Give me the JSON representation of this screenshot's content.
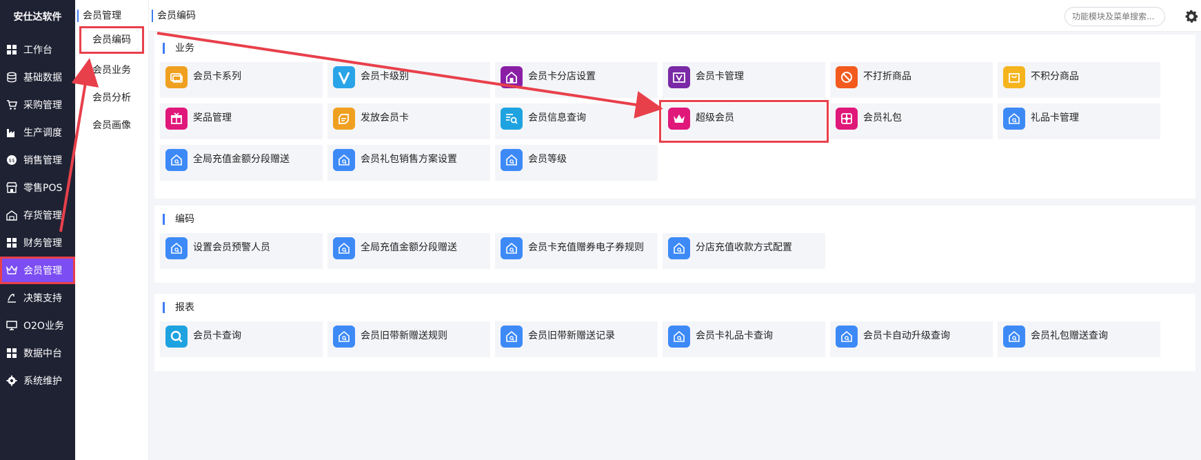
{
  "brand": "安仕达软件",
  "nav": [
    {
      "label": "工作台",
      "icon": "grid-icon"
    },
    {
      "label": "基础数据",
      "icon": "database-icon"
    },
    {
      "label": "采购管理",
      "icon": "cart-icon"
    },
    {
      "label": "生产调度",
      "icon": "factory-icon"
    },
    {
      "label": "销售管理",
      "icon": "sales-icon"
    },
    {
      "label": "零售POS",
      "icon": "store-icon"
    },
    {
      "label": "存货管理",
      "icon": "warehouse-icon"
    },
    {
      "label": "财务管理",
      "icon": "grid-icon"
    },
    {
      "label": "会员管理",
      "icon": "crown-icon"
    },
    {
      "label": "决策支持",
      "icon": "chart-icon"
    },
    {
      "label": "O2O业务",
      "icon": "monitor-icon"
    },
    {
      "label": "数据中台",
      "icon": "grid-icon"
    },
    {
      "label": "系统维护",
      "icon": "gear-icon"
    }
  ],
  "sub": {
    "title": "会员管理",
    "items": [
      {
        "label": "会员编码"
      },
      {
        "label": "会员业务"
      },
      {
        "label": "会员分析"
      },
      {
        "label": "会员画像"
      }
    ]
  },
  "topbar": {
    "breadcrumb": "会员编码",
    "search_placeholder": "功能模块及菜单搜索..."
  },
  "sections": [
    {
      "title": "业务",
      "cards": [
        {
          "label": "会员卡系列",
          "icon": "card-series-icon",
          "color": "#f0a020"
        },
        {
          "label": "会员卡级别",
          "icon": "v-level-icon",
          "color": "#2aa4e8"
        },
        {
          "label": "会员卡分店设置",
          "icon": "store-setting-icon",
          "color": "#8a1fa6"
        },
        {
          "label": "会员卡管理",
          "icon": "v-card-icon",
          "color": "#7a2aa6"
        },
        {
          "label": "不打折商品",
          "icon": "no-discount-icon",
          "color": "#f25a1e"
        },
        {
          "label": "不积分商品",
          "icon": "bag-icon",
          "color": "#f5b41e"
        },
        {
          "label": "奖品管理",
          "icon": "gift-icon",
          "color": "#e0187a"
        },
        {
          "label": "发放会员卡",
          "icon": "issue-card-icon",
          "color": "#f0a020"
        },
        {
          "label": "会员信息查询",
          "icon": "search-list-icon",
          "color": "#1fa3e0"
        },
        {
          "label": "超级会员",
          "icon": "crown-icon",
          "color": "#e0187a"
        },
        {
          "label": "会员礼包",
          "icon": "package-icon",
          "color": "#e0187a"
        },
        {
          "label": "礼品卡管理",
          "icon": "home-search-icon",
          "color": "#3d8af7"
        },
        {
          "label": "全局充值金额分段赠送",
          "icon": "home-search-icon",
          "color": "#3d8af7"
        },
        {
          "label": "会员礼包销售方案设置",
          "icon": "home-search-icon",
          "color": "#3d8af7"
        },
        {
          "label": "会员等级",
          "icon": "home-search-icon",
          "color": "#3d8af7"
        }
      ]
    },
    {
      "title": "编码",
      "cards": [
        {
          "label": "设置会员预警人员",
          "icon": "home-search-icon",
          "color": "#3d8af7"
        },
        {
          "label": "全局充值金额分段赠送",
          "icon": "home-search-icon",
          "color": "#3d8af7"
        },
        {
          "label": "会员卡充值赠券电子券规则",
          "icon": "home-search-icon",
          "color": "#3d8af7"
        },
        {
          "label": "分店充值收款方式配置",
          "icon": "home-search-icon",
          "color": "#3d8af7"
        }
      ]
    },
    {
      "title": "报表",
      "cards": [
        {
          "label": "会员卡查询",
          "icon": "magnifier-icon",
          "color": "#1fa3e0"
        },
        {
          "label": "会员旧带新赠送规则",
          "icon": "home-search-icon",
          "color": "#3d8af7"
        },
        {
          "label": "会员旧带新赠送记录",
          "icon": "home-search-icon",
          "color": "#3d8af7"
        },
        {
          "label": "会员卡礼品卡查询",
          "icon": "home-search-icon",
          "color": "#3d8af7"
        },
        {
          "label": "会员卡自动升级查询",
          "icon": "home-search-icon",
          "color": "#3d8af7"
        },
        {
          "label": "会员礼包赠送查询",
          "icon": "home-search-icon",
          "color": "#3d8af7"
        }
      ]
    }
  ],
  "colors": {
    "accent": "#7b4df2",
    "highlight": "#e8404b",
    "sidebar": "#1f2233",
    "link": "#3d7cf5"
  }
}
